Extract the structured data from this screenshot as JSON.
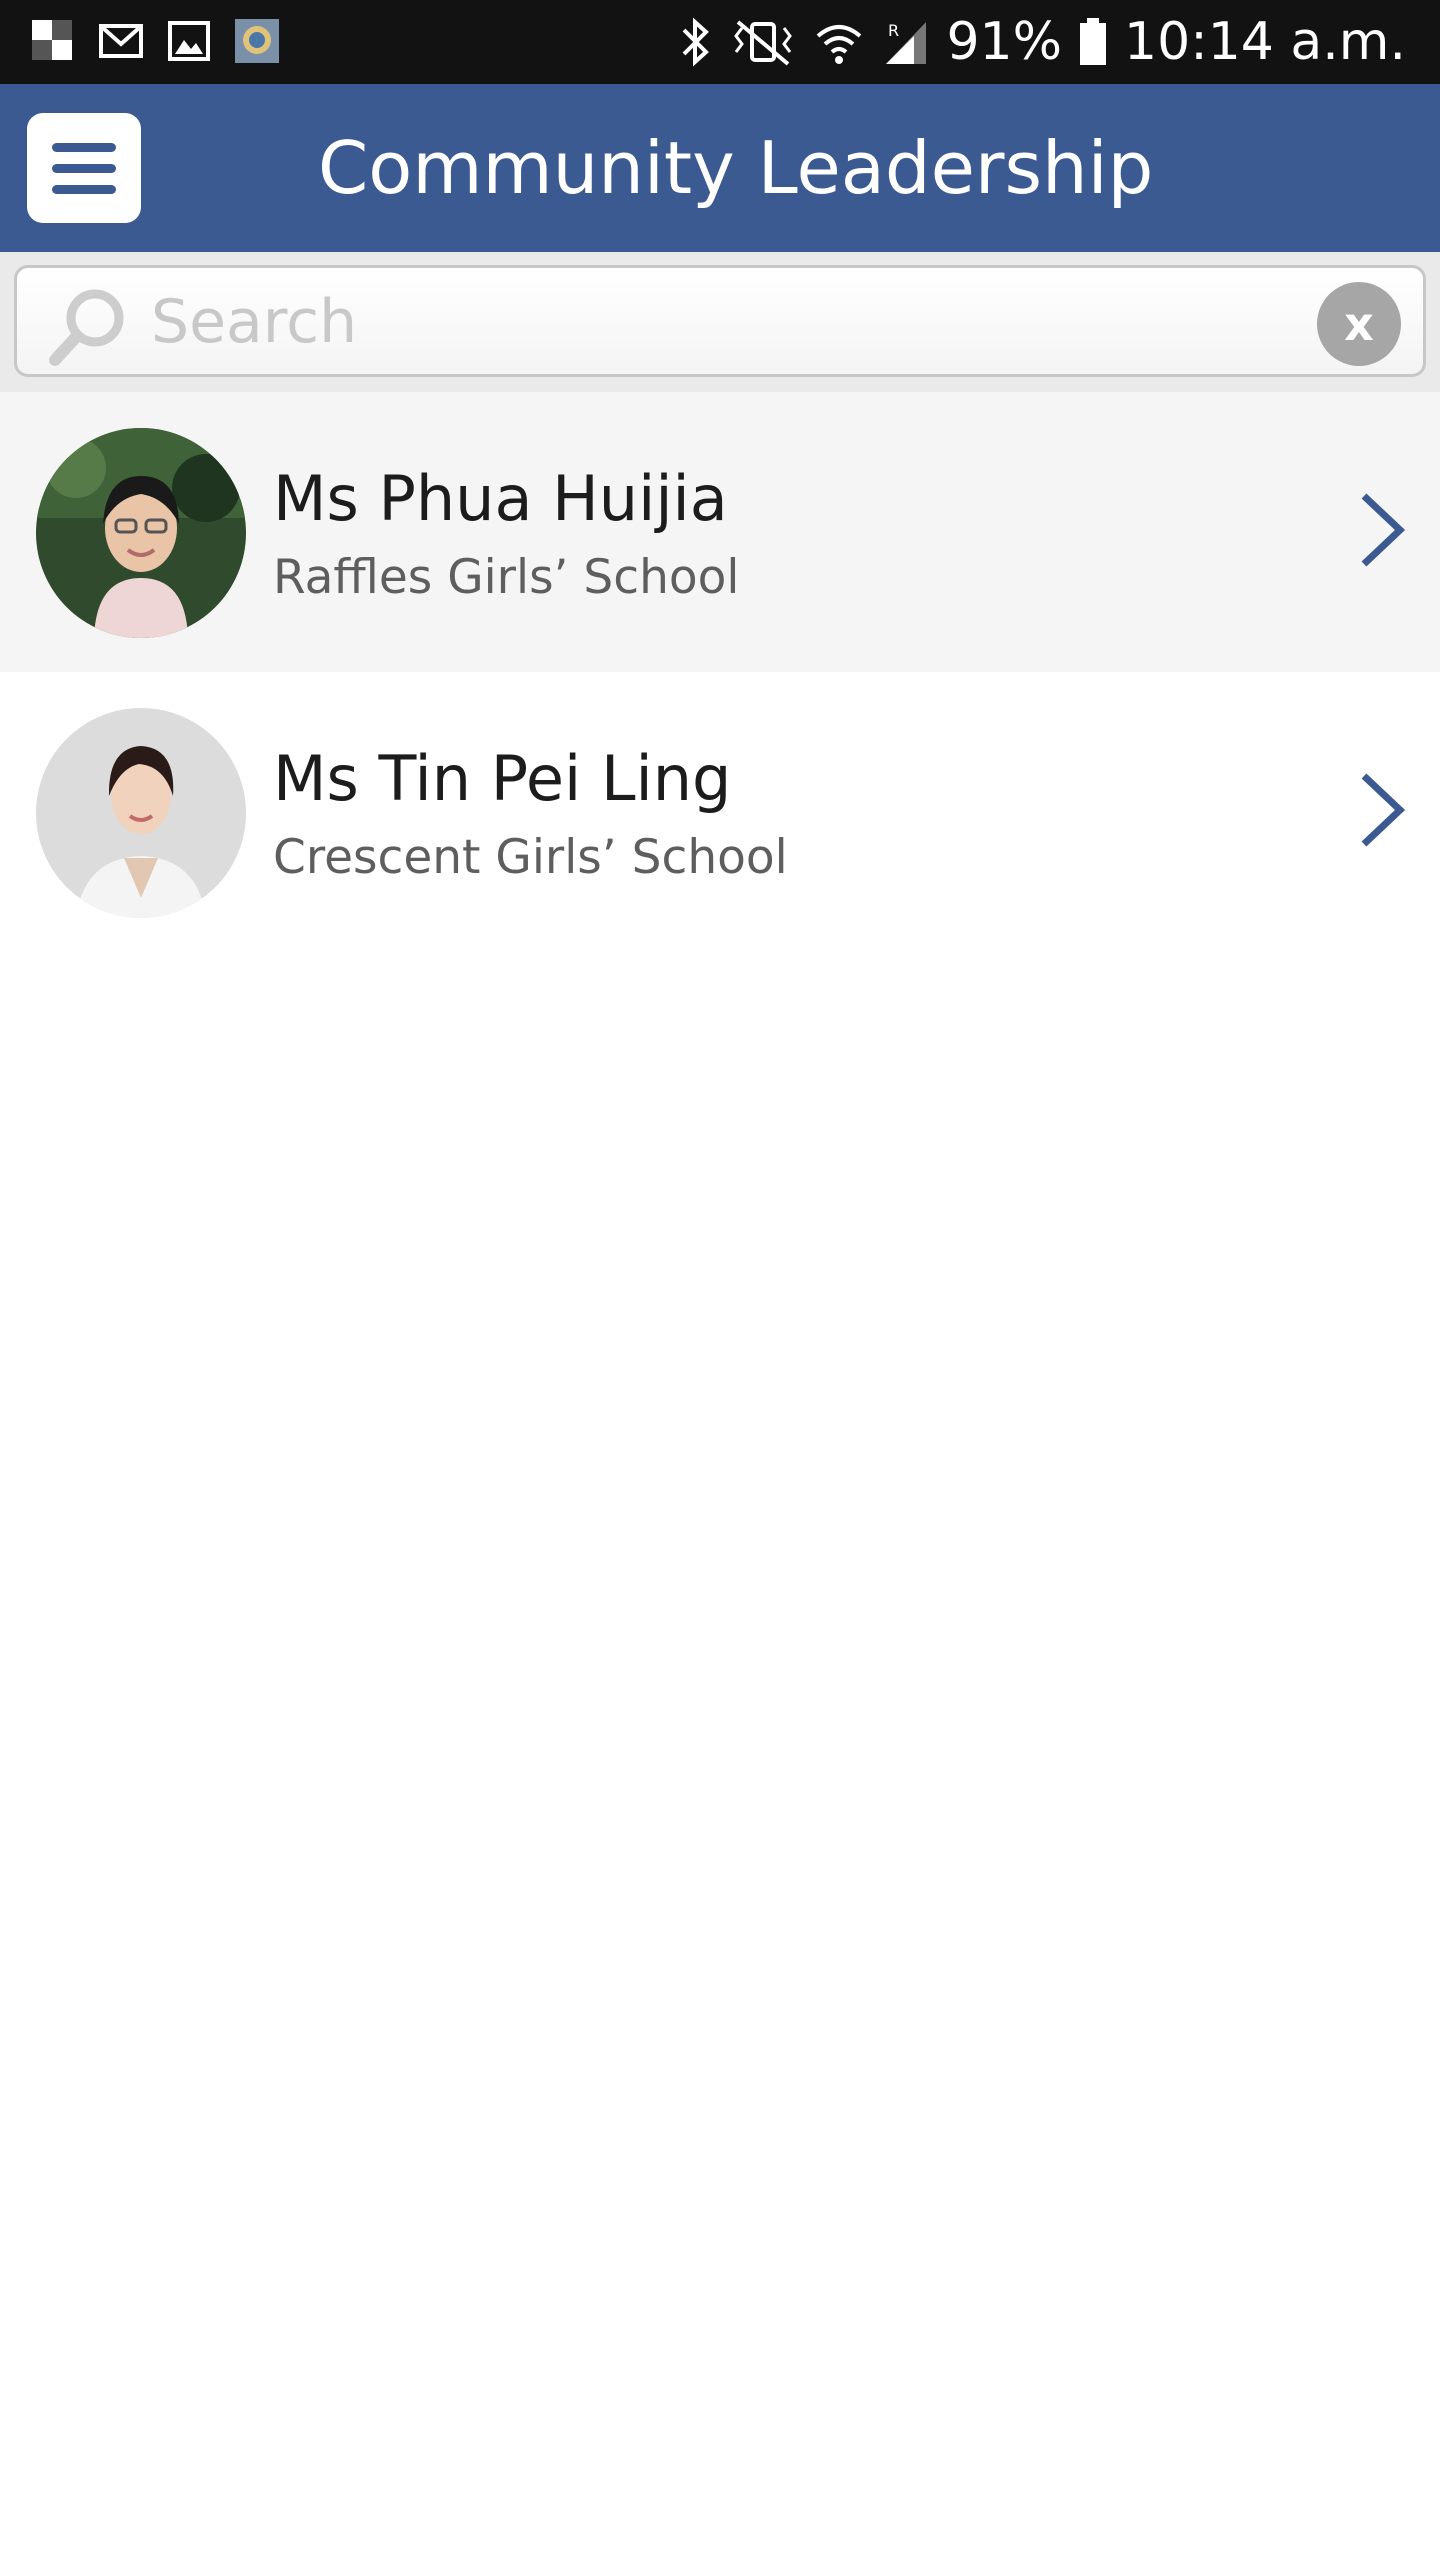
{
  "status_bar": {
    "left_icons": [
      "notification-icon",
      "gmail-icon",
      "gallery-icon",
      "app-icon"
    ],
    "right_icons": [
      "bluetooth-icon",
      "vibrate-icon",
      "wifi-icon",
      "signal-icon",
      "battery-icon"
    ],
    "battery": "91%",
    "time": "10:14 a.m."
  },
  "header": {
    "title": "Community Leadership",
    "background": "#3c5a92"
  },
  "search": {
    "placeholder": "Search",
    "value": "",
    "clear_label": "x"
  },
  "list": [
    {
      "name": "Ms Phua Huijia",
      "school": "Raffles Girls’ School"
    },
    {
      "name": "Ms Tin Pei Ling",
      "school": "Crescent Girls’ School"
    }
  ]
}
